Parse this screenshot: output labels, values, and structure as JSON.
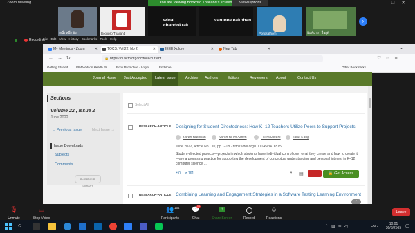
{
  "zoom": {
    "window_title": "Zoom Meeting",
    "share_banner": "You are viewing Bookpro Thailand's screen",
    "view_options": "View Options",
    "recording": "Recording",
    "participants": [
      {
        "name": "หนึ่ง หนึ่ง ชัย"
      },
      {
        "name": "Bookpro Thailand"
      },
      {
        "name": "winai chandokrak"
      },
      {
        "name": "varunee eakphan"
      },
      {
        "name": "Pongsathorn"
      },
      {
        "name": "พิมพ์นารา รื่นฤดี"
      }
    ],
    "toolbar": {
      "unmute": "Unmute",
      "stop_video": "Stop Video",
      "participants": "Participants",
      "participants_count": "154",
      "chat": "Chat",
      "chat_badge": "16",
      "share_screen": "Share Screen",
      "record": "Record",
      "reactions": "Reactions",
      "leave": "Leave"
    }
  },
  "browser": {
    "menu": [
      "File",
      "Edit",
      "View",
      "History",
      "Bookmarks",
      "Tools",
      "Help"
    ],
    "tabs": [
      {
        "label": "My Meetings - Zoom"
      },
      {
        "label": "TOCS: Vol 22, No 2"
      },
      {
        "label": "IEEE Xplore"
      },
      {
        "label": "New Tab"
      }
    ],
    "url": "https://dl.acm.org/toc/toce/current",
    "bookmarks": [
      "Getting Started",
      "IBM Watson Health Pr...",
      "Book Promotion - Login",
      "EndNote"
    ],
    "other_bookmarks": "Other Bookmarks"
  },
  "site": {
    "nav": [
      "Journal Home",
      "Just Accepted",
      "Latest Issue",
      "Archive",
      "Authors",
      "Editors",
      "Reviewers",
      "About",
      "Contact Us"
    ],
    "sidebar": {
      "sections_heading": "Sections",
      "volume": "Volume 22 , Issue 2",
      "date": "June 2022",
      "prev_issue": "Previous Issue",
      "next_issue": "Next Issue",
      "issue_downloads": "Issue Downloads",
      "subjects": "Subjects",
      "comments": "Comments",
      "acm_logo": "ACM DIGITAL LIBRARY"
    },
    "select_all": "Select All",
    "articles": [
      {
        "type": "RESEARCH-ARTICLE",
        "title": "Designing for Student-Directedness: How K–12 Teachers Utilize Peers to Support Projects",
        "authors": [
          "Karen Brennan",
          "Sarah Blum-Smith",
          "Laura Peters",
          "Jane Kang"
        ],
        "meta": "June 2022, Article No.: 10, pp 1–18",
        "doi": "https://doi.org/10.1145/3476515",
        "abstract": "Student-directed projects—projects in which students have individual control over what they create and how to create it—are a promising practice for supporting the development of conceptual understanding and personal interest in K–12 computer science ...",
        "citations": "0",
        "downloads": "161",
        "get_access": "Get Access"
      },
      {
        "type": "RESEARCH-ARTICLE",
        "title": "Combining Learning and Engagement Strategies in a Software Testing Learning Environment"
      }
    ]
  },
  "taskbar": {
    "language": "ENG",
    "time": "10:01",
    "date": "30/3/2565"
  }
}
